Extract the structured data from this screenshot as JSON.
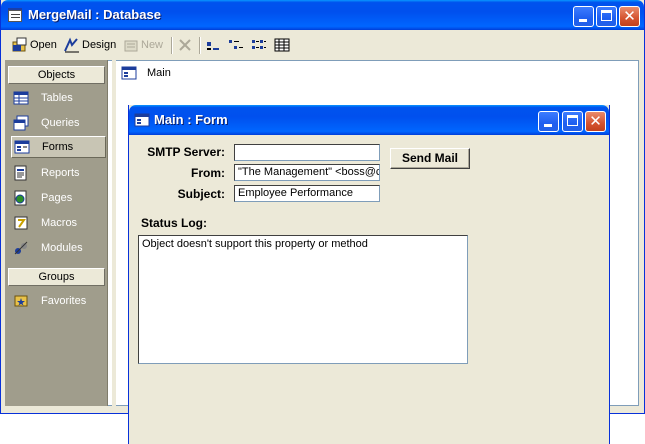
{
  "db_window": {
    "title": "MergeMail : Database",
    "toolbar": {
      "open_label": "Open",
      "design_label": "Design",
      "new_label": "New"
    },
    "objects_header": "Objects",
    "objects": [
      {
        "label": "Tables",
        "icon": "table-icon"
      },
      {
        "label": "Queries",
        "icon": "query-icon"
      },
      {
        "label": "Forms",
        "icon": "form-icon",
        "selected": true
      },
      {
        "label": "Reports",
        "icon": "report-icon"
      },
      {
        "label": "Pages",
        "icon": "page-icon"
      },
      {
        "label": "Macros",
        "icon": "macro-icon"
      },
      {
        "label": "Modules",
        "icon": "module-icon"
      }
    ],
    "groups_header": "Groups",
    "groups": [
      {
        "label": "Favorites",
        "icon": "favorites-icon"
      }
    ],
    "list_items": [
      {
        "label": "Main",
        "icon": "form-icon"
      }
    ]
  },
  "form_window": {
    "title": "Main : Form",
    "smtp_label": "SMTP Server:",
    "smtp_value": "",
    "from_label": "From:",
    "from_value": "\"The Management\" <boss@c",
    "subject_label": "Subject:",
    "subject_value": "Employee Performance",
    "send_button": "Send Mail",
    "status_label": "Status Log:",
    "status_text": "Object doesn't support this property or method"
  },
  "colors": {
    "titlebar_blue": "#0053ee",
    "window_face": "#ece9d8",
    "objects_bar": "#a09d8c",
    "close_red": "#d5532f"
  }
}
